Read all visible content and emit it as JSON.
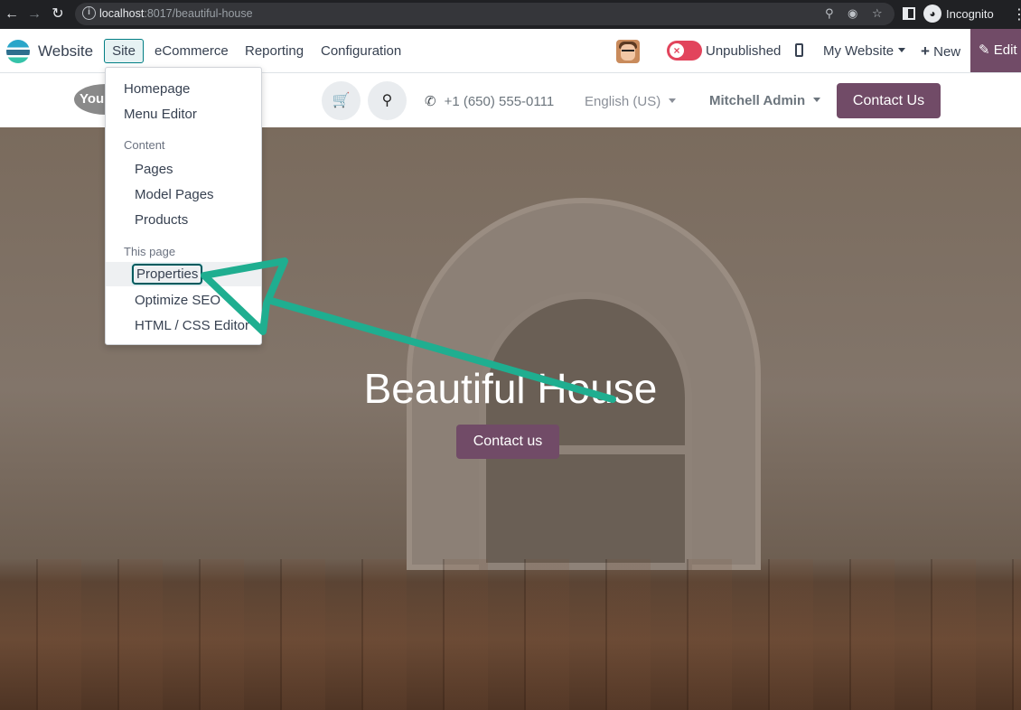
{
  "browser": {
    "url_host": "localhost",
    "url_path": ":8017/beautiful-house",
    "profile_label": "Incognito",
    "icons": [
      "back-arrow-icon",
      "forward-arrow-icon",
      "reload-icon",
      "info-icon",
      "zoom-icon",
      "eye-off-icon",
      "star-icon",
      "side-panel-icon",
      "incognito-icon",
      "kebab-menu-icon"
    ]
  },
  "odoo_bar": {
    "app_name": "Website",
    "menus": [
      "Site",
      "eCommerce",
      "Reporting",
      "Configuration"
    ],
    "publish_status": "Unpublished",
    "website_selector": "My Website",
    "new_label": "New",
    "edit_label": "Edit",
    "edit_color": "#714b67",
    "toggle_color": "#e2445c"
  },
  "site_header": {
    "logo_text": "You",
    "phone": "+1 (650) 555-0111",
    "language": "English (US)",
    "user": "Mitchell Admin",
    "contact_button": "Contact Us",
    "brand_color": "#714b67"
  },
  "hero": {
    "title": "Beautiful House",
    "button": "Contact us"
  },
  "site_menu": {
    "items_top": [
      "Homepage",
      "Menu Editor"
    ],
    "content_header": "Content",
    "content_items": [
      "Pages",
      "Model Pages",
      "Products"
    ],
    "page_header": "This page",
    "page_items": [
      "Properties",
      "Optimize SEO",
      "HTML / CSS Editor"
    ],
    "highlighted_item": "Properties"
  },
  "annotation_color": "#1fae90"
}
